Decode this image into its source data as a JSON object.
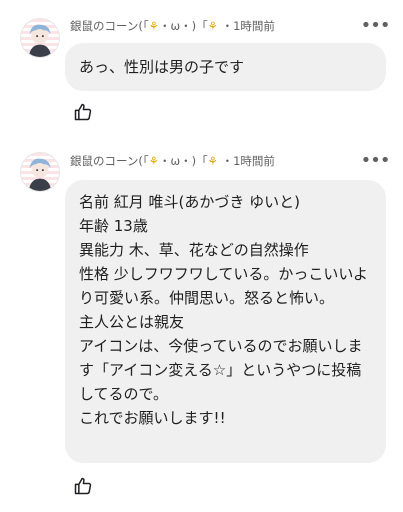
{
  "comments": [
    {
      "author": "銀鼠のコーン(「",
      "author_tail": "・ω・)「",
      "time_sep": "・",
      "time": "1時間前",
      "more_icon": "more-horizontal-icon",
      "text": "あっ、性別は男の子です",
      "like_icon": "thumbs-up-icon"
    },
    {
      "author": "銀鼠のコーン(「",
      "author_tail": "・ω・)「",
      "time_sep": "・",
      "time": "1時間前",
      "more_icon": "more-horizontal-icon",
      "text": "名前 紅月 唯斗(あかづき ゆいと)\n年齢 13歳\n異能力 木、草、花などの自然操作\n性格 少しフワフワしている。かっこいいより可愛い系。仲間思い。怒ると怖い。\n主人公とは親友\nアイコンは、今使っているのでお願いします「アイコン変える☆」というやつに投稿してるので。\nこれでお願いします!!",
      "like_icon": "thumbs-up-icon"
    }
  ],
  "colors": {
    "bubble": "#f0f0f0",
    "meta_text": "#606060",
    "corn": "#e0a800",
    "avatar_stripe": "#fbe3e6"
  }
}
